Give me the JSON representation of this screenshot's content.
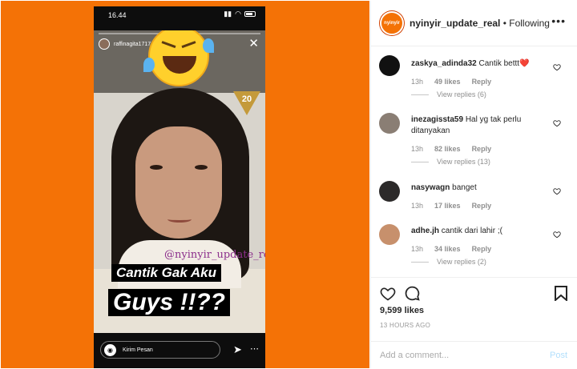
{
  "story": {
    "time": "16.44",
    "username": "raffinagita1717_",
    "badge": "20",
    "watermark": "@nyinyir_update_real",
    "caption_line1": "Cantik Gak Aku",
    "caption_line2": "Guys !!??",
    "reply_placeholder": "Kirim Pesan",
    "close_glyph": "✕",
    "send_glyph": "➤",
    "more_glyph": "⋯"
  },
  "post": {
    "account": "nyinyir_update_real",
    "separator": " • ",
    "follow_state": "Following",
    "more_glyph": "•••"
  },
  "comments": [
    {
      "user": "zaskya_adinda32",
      "text": "Cantik bettt❤️",
      "time": "13h",
      "likes": "49 likes",
      "reply": "Reply",
      "views": "View replies (6)",
      "avatar_color": "#111111"
    },
    {
      "user": "inezagissta59",
      "text": "Hal yg tak perlu ditanyakan",
      "time": "13h",
      "likes": "82 likes",
      "reply": "Reply",
      "views": "View replies (13)",
      "avatar_color": "#8a7e74"
    },
    {
      "user": "nasywagn",
      "text": "banget",
      "time": "13h",
      "likes": "17 likes",
      "reply": "Reply",
      "views": "",
      "avatar_color": "#2c2a2a"
    },
    {
      "user": "adhe.jh",
      "text": "cantik dari lahir ;(",
      "time": "13h",
      "likes": "34 likes",
      "reply": "Reply",
      "views": "View replies (2)",
      "avatar_color": "#c7906c"
    }
  ],
  "actions": {
    "likes": "9,599 likes",
    "ago": "13 HOURS AGO",
    "comment_placeholder": "Add a comment...",
    "post_label": "Post"
  },
  "colors": {
    "background": "#f47206",
    "link_blue": "#b2dffc"
  }
}
